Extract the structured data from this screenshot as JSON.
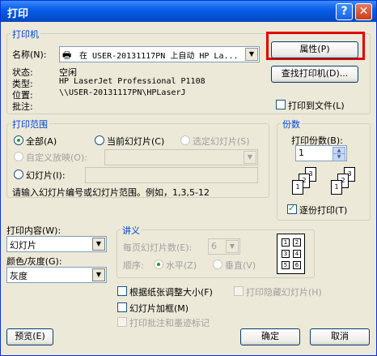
{
  "window": {
    "title": "打印",
    "help": "?",
    "close": "✕"
  },
  "printer": {
    "group_label": "打印机",
    "name_label": "名称(N):",
    "name_value": "在 USER-20131117PN 上自动 HP La...",
    "properties_button": "属性(P)",
    "find_button": "查找打印机(D)...",
    "status_label": "状态:",
    "status_value": "空闲",
    "type_label": "类型:",
    "type_value": "HP LaserJet Professional P1108",
    "where_label": "位置:",
    "where_value": "\\\\USER-20131117PN\\HPLaserJ",
    "comment_label": "批注:",
    "print_to_file": "打印到文件(L)"
  },
  "range": {
    "group_label": "打印范围",
    "all": "全部(A)",
    "current": "当前幻灯片(C)",
    "selection": "选定幻灯片(S)",
    "custom": "自定义放映(O):",
    "slides": "幻灯片(I):",
    "hint": "请输入幻灯片编号或幻灯片范围。例如，1,3,5-12"
  },
  "copies": {
    "group_label": "份数",
    "count_label": "打印份数(B):",
    "count_value": "1",
    "collate": "逐份打印(T)"
  },
  "content": {
    "print_what_label": "打印内容(W):",
    "print_what_value": "幻灯片",
    "color_label": "颜色/灰度(G):",
    "color_value": "灰度"
  },
  "handouts": {
    "group_label": "讲义",
    "per_page_label": "每页幻灯片数(E):",
    "per_page_value": "6",
    "order_label": "顺序:",
    "horizontal": "水平(Z)",
    "vertical": "垂直(V)"
  },
  "options": {
    "scale": "根据纸张调整大小(F)",
    "hidden": "打印隐藏幻灯片(H)",
    "frame": "幻灯片加框(M)",
    "comments": "打印批注和墨迹标记"
  },
  "buttons": {
    "preview": "预览(E)",
    "ok": "确定",
    "cancel": "取消"
  }
}
